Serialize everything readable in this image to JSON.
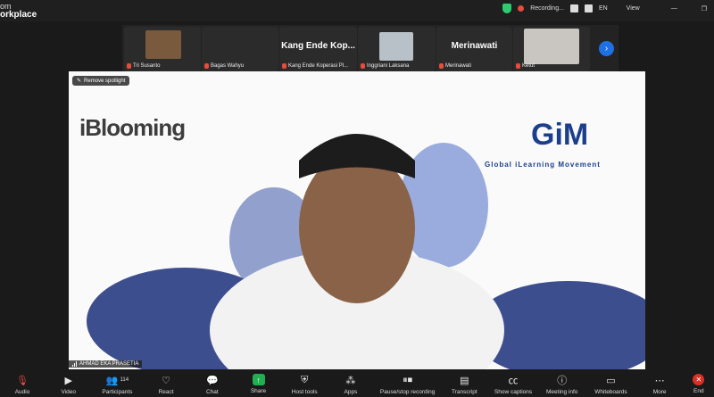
{
  "app": {
    "brand_line1": "om",
    "brand_line2": "orkplace"
  },
  "titlebar": {
    "recording": "Recording...",
    "lang": "EN",
    "view": "View"
  },
  "thumbnails": [
    {
      "name": "Tri Susanto",
      "big": ""
    },
    {
      "name": "Bagas Wahyu",
      "big": ""
    },
    {
      "name": "Kang Ende Koperasi Pl...",
      "big": "Kang Ende Kop..."
    },
    {
      "name": "Inggriani Laksana",
      "big": ""
    },
    {
      "name": "Merinawati",
      "big": "Merinawati"
    },
    {
      "name": "Ketut",
      "big": ""
    }
  ],
  "stage": {
    "spotlight": "Remove spotlight",
    "speaker": "AHMAD EKA PRASETIA",
    "logo_left": "iBlooming",
    "logo_right": "GiM",
    "logo_right_sub": "Global iLearning Movement"
  },
  "toolbar": {
    "audio": "Audio",
    "video": "Video",
    "participants": "Participants",
    "participants_count": "114",
    "react": "React",
    "chat": "Chat",
    "share": "Share",
    "host_tools": "Host tools",
    "apps": "Apps",
    "pause_stop": "Pause/stop recording",
    "transcript": "Transcript",
    "captions": "Show captions",
    "meeting_info": "Meeting info",
    "whiteboards": "Whiteboards",
    "more": "More",
    "end": "End"
  },
  "colors": {
    "accent": "#1f6fe5",
    "share": "#20b050",
    "end": "#d93025",
    "recording": "#e74c3c"
  }
}
